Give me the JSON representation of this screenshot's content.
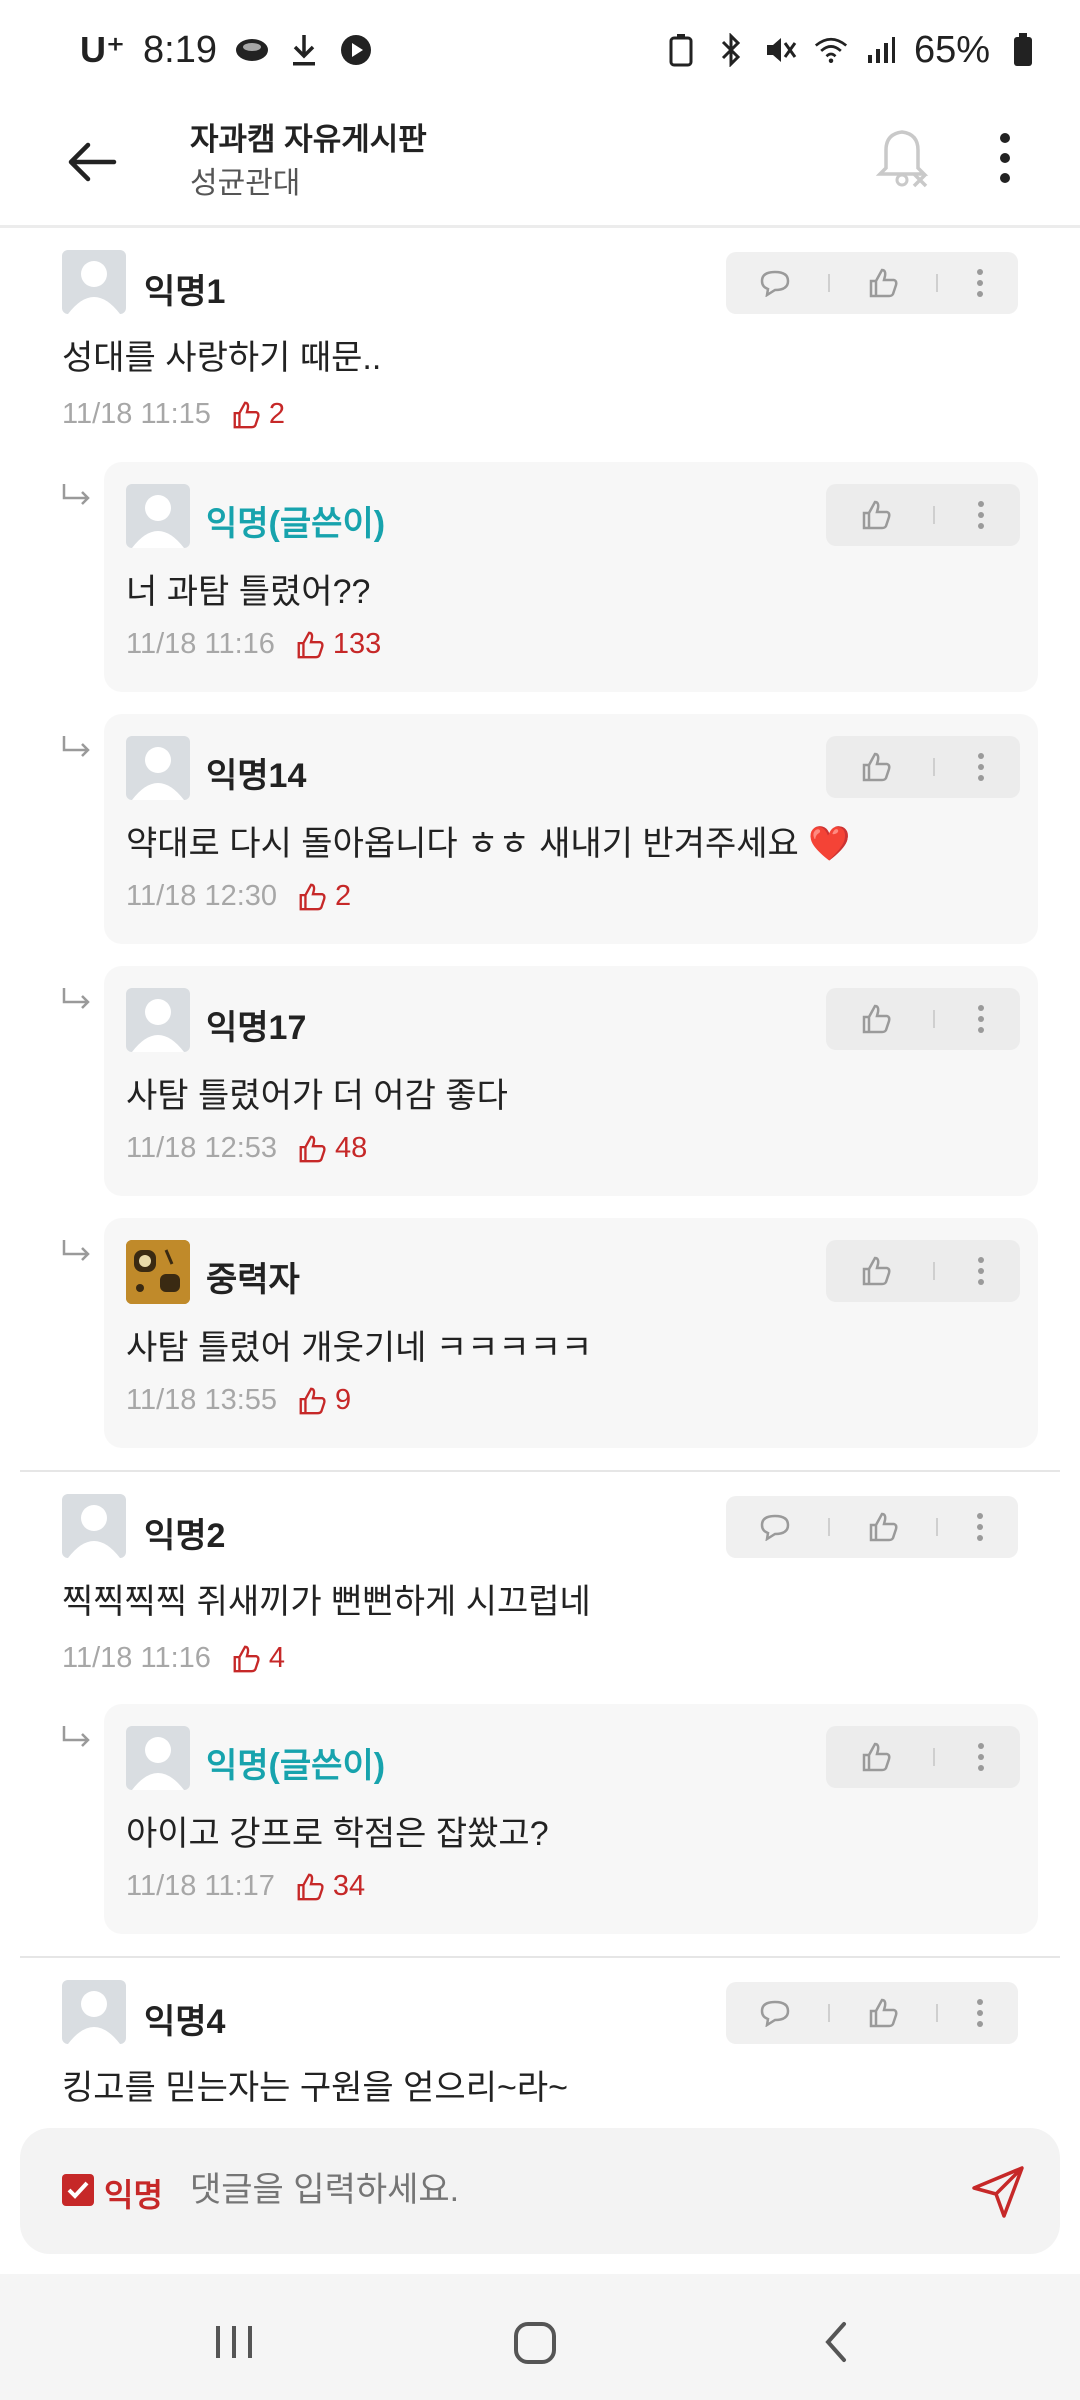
{
  "status": {
    "carrier": "U⁺",
    "time": "8:19",
    "battery": "65%"
  },
  "header": {
    "title": "자과캠 자유게시판",
    "subtitle": "성균관대"
  },
  "comments": [
    {
      "author": "익명1",
      "text": "성대를 사랑하기 때문..",
      "date": "11/18 11:15",
      "likes": "2"
    },
    {
      "author": "익명(글쓴이)",
      "text": "너 과탐 틀렸어??",
      "date": "11/18 11:16",
      "likes": "133"
    },
    {
      "author": "익명14",
      "text": "약대로 다시 돌아옵니다 ㅎㅎ 새내기 반겨주세요 ❤️",
      "date": "11/18 12:30",
      "likes": "2"
    },
    {
      "author": "익명17",
      "text": "사탐 틀렸어가 더 어감 좋다",
      "date": "11/18 12:53",
      "likes": "48"
    },
    {
      "author": "중력자",
      "text": "사탐 틀렸어 개웃기네 ㅋㅋㅋㅋㅋ",
      "date": "11/18 13:55",
      "likes": "9"
    },
    {
      "author": "익명2",
      "text": "찍찍찍찍 쥐새끼가 뻔뻔하게 시끄럽네",
      "date": "11/18 11:16",
      "likes": "4"
    },
    {
      "author": "익명(글쓴이)",
      "text": "아이고 강프로 학점은 잡쐈고?",
      "date": "11/18 11:17",
      "likes": "34"
    },
    {
      "author": "익명4",
      "text": "킹고를 믿는자는 구원을 얻으리~라~"
    }
  ],
  "input": {
    "anonymous_label": "익명",
    "placeholder": "댓글을 입력하세요."
  },
  "colors": {
    "accent_red": "#c62828",
    "author_op": "#17a3ad"
  }
}
